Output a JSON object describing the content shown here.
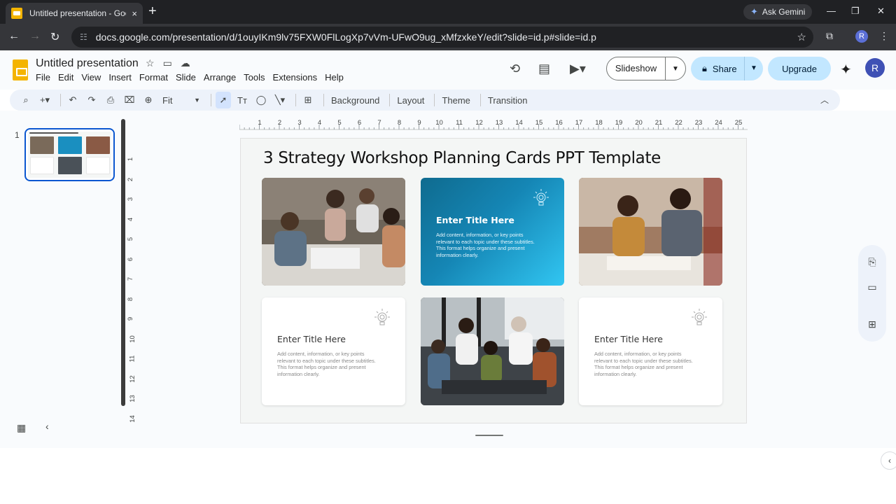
{
  "browser": {
    "tab_title": "Untitled presentation - Google",
    "tab_close": "×",
    "new_tab": "+",
    "gemini_label": "Ask Gemini",
    "url": "docs.google.com/presentation/d/1ouyIKm9lv75FXW0FlLogXp7vVm-UFwO9ug_xMfzxkeY/edit?slide=id.p#slide=id.p",
    "profile_initial": "R"
  },
  "app": {
    "doc_title": "Untitled presentation",
    "menus": [
      "File",
      "Edit",
      "View",
      "Insert",
      "Format",
      "Slide",
      "Arrange",
      "Tools",
      "Extensions",
      "Help"
    ],
    "slideshow_label": "Slideshow",
    "share_label": "Share",
    "upgrade_label": "Upgrade",
    "avatar_initial": "R"
  },
  "toolbar": {
    "zoom_label": "Fit",
    "background_label": "Background",
    "layout_label": "Layout",
    "theme_label": "Theme",
    "transition_label": "Transition"
  },
  "filmstrip": {
    "slide_number": "1"
  },
  "ruler": {
    "h_ticks": [
      "1",
      "2",
      "3",
      "4",
      "5",
      "6",
      "7",
      "8",
      "9",
      "10",
      "11",
      "12",
      "13",
      "14",
      "15",
      "16",
      "17",
      "18",
      "19",
      "20",
      "21",
      "22",
      "23",
      "24",
      "25"
    ],
    "v_ticks": [
      "1",
      "2",
      "3",
      "4",
      "5",
      "6",
      "7",
      "8",
      "9",
      "10",
      "11",
      "12",
      "13",
      "14"
    ]
  },
  "slide": {
    "title": "3 Strategy Workshop Planning Cards PPT Template",
    "cards": [
      {
        "title": "Enter Title Here",
        "body": "Add content, information, or key points relevant to each topic under these subtitles. This format helps organize and present information clearly."
      },
      {
        "title": "Enter Title Here",
        "body": "Add content, information, or key points relevant to each topic under these subtitles. This format helps organize and present information clearly."
      },
      {
        "title": "Enter Title Here",
        "body": "Add content, information, or key points relevant to each topic under these subtitles. This format helps organize and present information clearly."
      }
    ]
  },
  "colors": {
    "accent_blue": "#0b57d0",
    "share_bg": "#c2e7ff",
    "card_gradient_start": "#0f6b8f",
    "card_gradient_end": "#31c6f2"
  }
}
